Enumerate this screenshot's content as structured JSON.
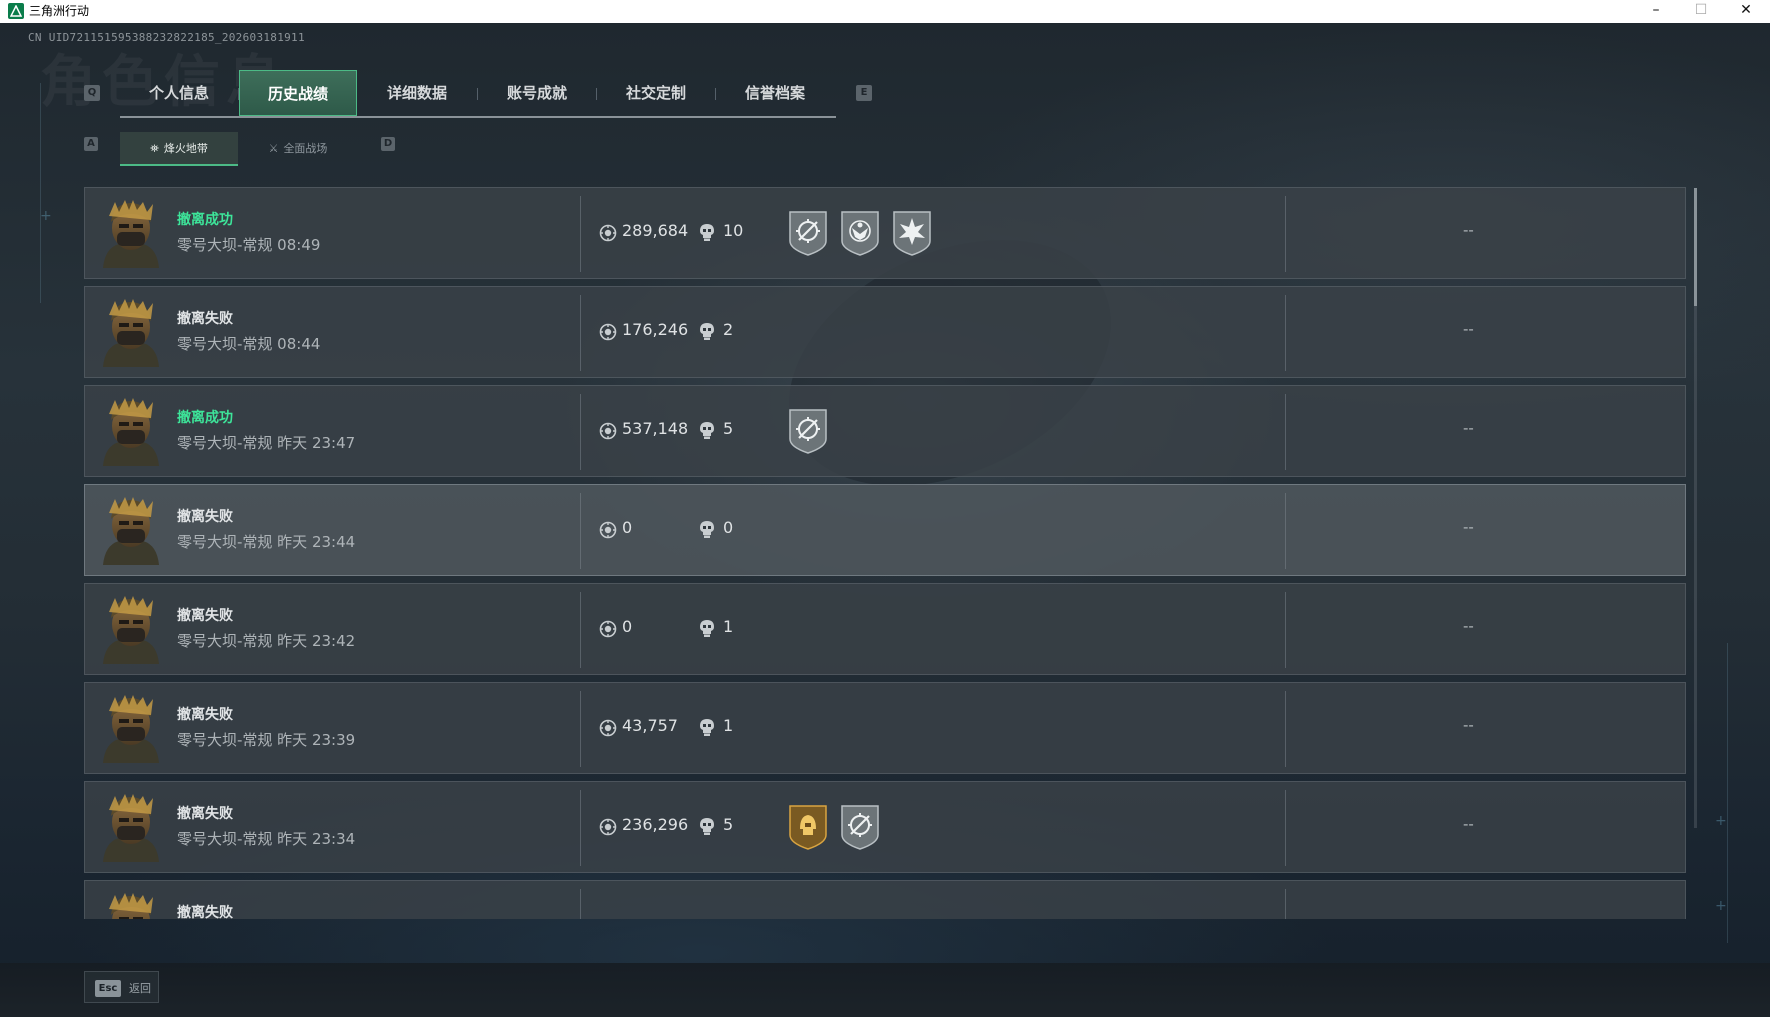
{
  "window": {
    "title": "三角洲行动",
    "min_glyph": "–",
    "max_glyph": "☐",
    "close_glyph": "✕"
  },
  "uid": "CN UID7211515953882328221​85_20260318191​1",
  "background_title": "角色信息",
  "key_hints": {
    "prev_tab": "Q",
    "next_tab": "E",
    "prev_sub": "A",
    "next_sub": "D"
  },
  "main_tabs": [
    "个人信息",
    "历史战绩",
    "详细数据",
    "账号成就",
    "社交定制",
    "信誉档案"
  ],
  "active_main_tab": "历史战绩",
  "sub_tabs": [
    {
      "label": "烽火地带",
      "icon": "hazard-zone-icon",
      "active": true
    },
    {
      "label": "全面战场",
      "icon": "battlefield-icon",
      "active": false
    }
  ],
  "records": [
    {
      "status": "撤离成功",
      "result": "success",
      "map": "零号大坝-常规 08:49",
      "value": "289,684",
      "kills": "10",
      "badges": [
        "crosshair-badge",
        "eagle-badge",
        "explosion-badge"
      ],
      "extra": "--"
    },
    {
      "status": "撤离失败",
      "result": "fail",
      "map": "零号大坝-常规 08:44",
      "value": "176,246",
      "kills": "2",
      "badges": [],
      "extra": "--"
    },
    {
      "status": "撤离成功",
      "result": "success",
      "map": "零号大坝-常规 昨天 23:47",
      "value": "537,148",
      "kills": "5",
      "badges": [
        "crosshair-badge"
      ],
      "extra": "--"
    },
    {
      "status": "撤离失败",
      "result": "fail",
      "map": "零号大坝-常规 昨天 23:44",
      "value": "0",
      "kills": "0",
      "badges": [],
      "extra": "--"
    },
    {
      "status": "撤离失败",
      "result": "fail",
      "map": "零号大坝-常规 昨天 23:42",
      "value": "0",
      "kills": "1",
      "badges": [],
      "extra": "--"
    },
    {
      "status": "撤离失败",
      "result": "fail",
      "map": "零号大坝-常规 昨天 23:39",
      "value": "43,757",
      "kills": "1",
      "badges": [],
      "extra": "--"
    },
    {
      "status": "撤离失败",
      "result": "fail",
      "map": "零号大坝-常规 昨天 23:34",
      "value": "236,296",
      "kills": "5",
      "badges": [
        "gold-helmet-badge",
        "crosshair-badge"
      ],
      "extra": "--"
    },
    {
      "status": "撤离失败",
      "result": "fail",
      "map": "",
      "value": "",
      "kills": "",
      "badges": [],
      "extra": ""
    }
  ],
  "footer": {
    "esc_key": "Esc",
    "back_label": "返回"
  },
  "colors": {
    "accent_green": "#3de59a",
    "tab_active": "#2e5a49"
  }
}
